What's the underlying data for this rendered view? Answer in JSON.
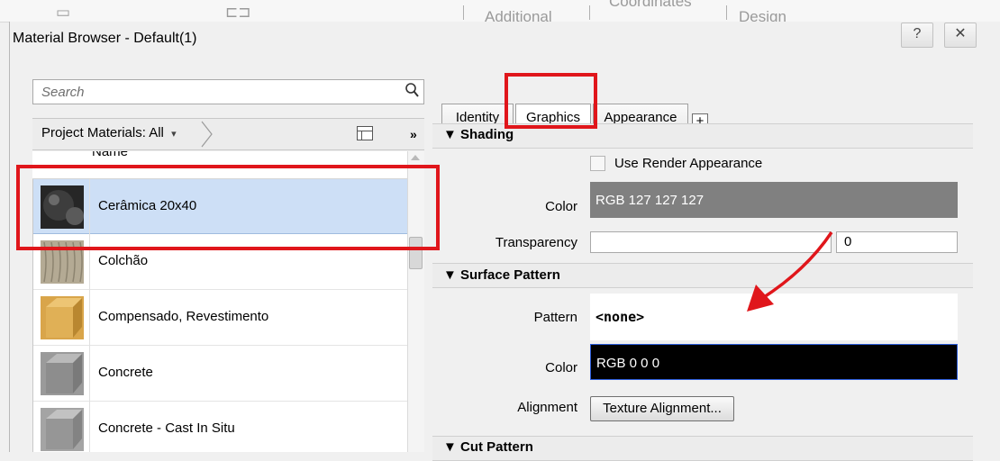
{
  "top_ribbon": {
    "additional": "Additional",
    "coordinates": "Coordinates",
    "design": "Design"
  },
  "window": {
    "title": "Material Browser - Default(1)",
    "help_label": "?",
    "close_label": "✕"
  },
  "left_panel": {
    "search_placeholder": "Search",
    "filter_label": "Project Materials: All",
    "filter_chevron": "▾",
    "more_label": "»",
    "column_header": "Name",
    "materials": [
      {
        "label": "Cerâmica 20x40",
        "selected": true,
        "swatch": "sphere-dark"
      },
      {
        "label": "Colchão",
        "selected": false,
        "swatch": "fabric"
      },
      {
        "label": "Compensado, Revestimento",
        "selected": false,
        "swatch": "wood"
      },
      {
        "label": "Concrete",
        "selected": false,
        "swatch": "concrete"
      },
      {
        "label": "Concrete - Cast In Situ",
        "selected": false,
        "swatch": "concrete"
      }
    ]
  },
  "tabs": [
    {
      "label": "Identity",
      "active": false
    },
    {
      "label": "Graphics",
      "active": true
    },
    {
      "label": "Appearance",
      "active": false
    }
  ],
  "add_tab_label": "+",
  "shading": {
    "title": "▼ Shading",
    "use_render_label": "Use Render Appearance",
    "use_render_checked": false,
    "color_label": "Color",
    "color_value": "RGB 127 127 127",
    "color_hex": "#7f7f7f",
    "transparency_label": "Transparency",
    "transparency_value": "0"
  },
  "surface_pattern": {
    "title": "▼ Surface Pattern",
    "pattern_label": "Pattern",
    "pattern_value": "<none>",
    "color_label": "Color",
    "color_value": "RGB 0 0 0",
    "color_hex": "#000000",
    "alignment_label": "Alignment",
    "alignment_button": "Texture Alignment..."
  },
  "cut_pattern": {
    "title": "▼ Cut Pattern"
  },
  "annotation_color": "#e0161b"
}
